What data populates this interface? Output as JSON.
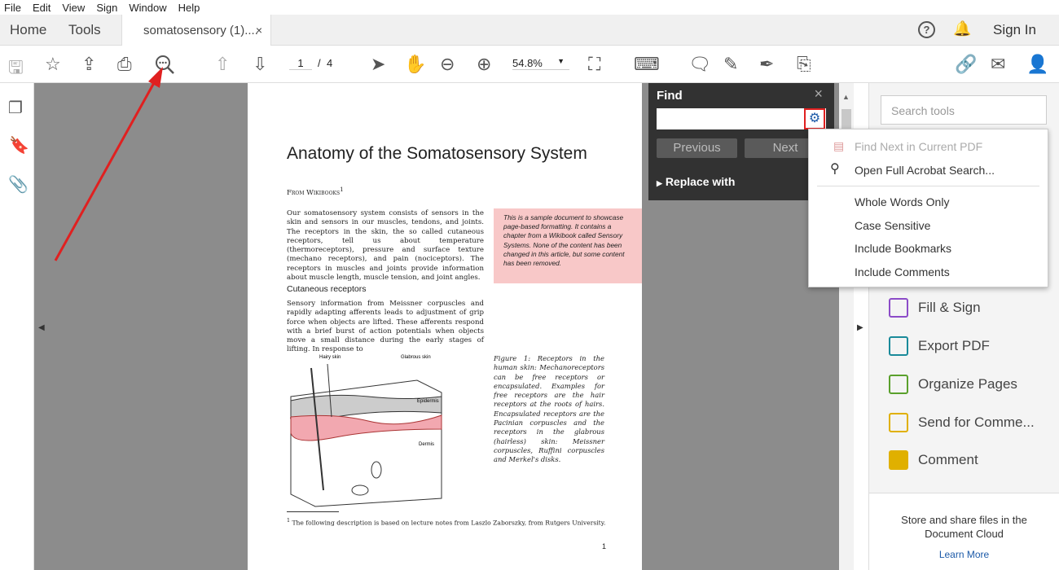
{
  "menu": [
    "File",
    "Edit",
    "View",
    "Sign",
    "Window",
    "Help"
  ],
  "tabs": {
    "home": "Home",
    "tools": "Tools",
    "doc": "somatosensory (1)....",
    "close": "×"
  },
  "header": {
    "sign_in": "Sign In"
  },
  "toolbar": {
    "page_current": "1",
    "page_sep": "/",
    "page_total": "4",
    "zoom": "54.8%"
  },
  "find": {
    "title": "Find",
    "close": "×",
    "input_value": "",
    "previous": "Previous",
    "next": "Next",
    "replace": "Replace with"
  },
  "dropdown": {
    "items": [
      "Find Next in Current PDF",
      "Open Full Acrobat Search...",
      "Whole Words Only",
      "Case Sensitive",
      "Include Bookmarks",
      "Include Comments"
    ]
  },
  "right": {
    "search_placeholder": "Search tools",
    "tools": [
      {
        "label": "Fill & Sign",
        "color": "#8c4cc8"
      },
      {
        "label": "Export PDF",
        "color": "#1a8a9a"
      },
      {
        "label": "Organize Pages",
        "color": "#5aa02c"
      },
      {
        "label": "Send for Comme...",
        "color": "#e0b000"
      },
      {
        "label": "Comment",
        "color": "#e0b000"
      }
    ],
    "cloud_text": "Store and share files in the Document Cloud",
    "learn_more": "Learn More"
  },
  "doc": {
    "title": "Anatomy of the Somatosensory System",
    "from": "From Wikibooks",
    "fnmark": "1",
    "para1": "Our somatosensory system consists of sensors in the skin and sensors in our muscles, tendons, and joints. The receptors in the skin, the so called cutaneous receptors, tell us about temperature (thermoreceptors), pressure and surface texture (mechano receptors), and pain (nociceptors). The receptors in muscles and joints provide information about muscle length, muscle tension, and joint angles.",
    "note": "This is a sample document to showcase page-based formatting. It contains a chapter from a Wikibook called Sensory Systems. None of the content has been changed in this article, but some content has been removed.",
    "heading": "Cutaneous receptors",
    "para2": "Sensory information from Meissner corpuscles and rapidly adapting afferents leads to adjustment of grip force when objects are lifted. These afferents respond with a brief burst of action potentials when objects move a small distance during the early stages of lifting. In response to",
    "caption": "Figure 1: Receptors in the human skin: Mechanoreceptors can be free receptors or encapsulated. Examples for free receptors are the hair receptors at the roots of hairs. Encapsulated receptors are the Pacinian corpuscles and the receptors in the glabrous (hairless) skin: Meissner corpuscles, Ruffini corpuscles and Merkel's disks.",
    "fig_labels": {
      "hairy": "Hairy skin",
      "glabrous": "Glabrous skin",
      "epidermis": "Epidermis",
      "dermis": "Dermis"
    },
    "footnote": "The following description is based on lecture notes from Laszlo Zaborszky, from Rutgers University.",
    "page_number": "1"
  },
  "colors": {
    "arrow": "#e02020",
    "highlight": "#e02020",
    "note_bg": "#f8c8c8"
  }
}
